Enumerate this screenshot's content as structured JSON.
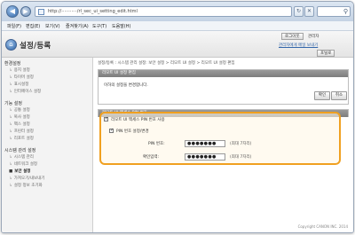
{
  "browser": {
    "url": "http://···········/rl_sec_ui_setting_edit.html",
    "menu": [
      "파일(F)",
      "편집(E)",
      "보기(V)",
      "즐겨찾기(A)",
      "도구(T)",
      "도움말(H)"
    ]
  },
  "header": {
    "title": "설정/등록",
    "logout": "로그아웃",
    "admin_user": "관리자",
    "mail_link": "관리자에게 메일 보내기",
    "portal_link": "포털로"
  },
  "sidebar": {
    "sections": [
      {
        "title": "환경설정",
        "items": [
          "용지 설정",
          "타이머 설정",
          "표시설정",
          "인터페이스 설정"
        ]
      },
      {
        "title": "기능 설정",
        "items": [
          "공통 설정",
          "복사 설정",
          "팩스 설정",
          "프린터 설정",
          "리포트 설정"
        ]
      },
      {
        "title": "시스템 관리 설정",
        "items": [
          "시스템 관리",
          "네트워크 설정",
          "보안 설정",
          "가져오기/내보내기",
          "설정 정보 초기화"
        ]
      }
    ],
    "active": "보안 설정"
  },
  "main": {
    "breadcrumb": "설정/등록 : 시스템 관리 설정: 보안 설정 > 리모트 UI 설정 > 리모트 UI 설정 편집",
    "panel1": {
      "title": "리모트 UI 설정 편집",
      "message": "이하의 설정을 변경합니다.",
      "ok": "확인",
      "cancel": "취소"
    },
    "panel2": {
      "title": "리모트 UI 액세스 PIN 번호",
      "use_pin_label": "리모트 UI 액세스 PIN 번호 사용",
      "set_pin_label": "PIN 번호 설정/변경",
      "pin_label": "PIN 번호:",
      "pin_value": "●●●●●●●",
      "pin_hint": "(최대 7자리)",
      "confirm_label": "확인입력:",
      "confirm_value": "●●●●●●●",
      "confirm_hint": "(최대 7자리)"
    }
  },
  "footer": {
    "copyright": "Copyright CANON INC. 2014"
  },
  "colors": {
    "highlight": "#f0a020",
    "panel_header": "#8a8a8a",
    "accent": "#2d63a6"
  }
}
